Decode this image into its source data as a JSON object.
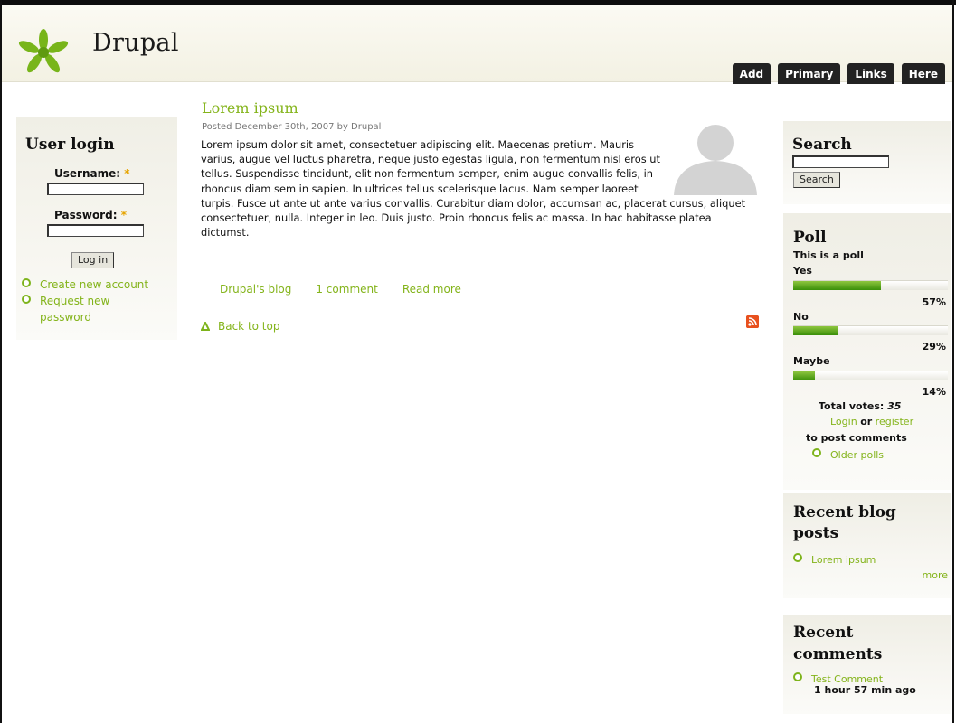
{
  "site": {
    "name": "Drupal",
    "logo_icon": "drupal-logo-icon",
    "accent_color": "#84b41b"
  },
  "nav": {
    "tabs": [
      "Add",
      "Primary",
      "Links",
      "Here"
    ]
  },
  "user_login": {
    "title": "User login",
    "username_label": "Username:",
    "password_label": "Password:",
    "required_marker": "*",
    "login_button": "Log in",
    "links": [
      "Create new account",
      "Request new password"
    ]
  },
  "post": {
    "title": "Lorem ipsum",
    "meta": "Posted December 30th, 2007 by Drupal",
    "body": "Lorem ipsum dolor sit amet, consectetuer adipiscing elit. Maecenas pretium. Mauris varius, augue vel luctus pharetra, neque justo egestas ligula, non fermentum nisl eros ut tellus. Suspendisse tincidunt, elit non fermentum semper, enim augue convallis felis, in rhoncus diam sem in sapien. In ultrices tellus scelerisque lacus. Nam semper laoreet turpis. Fusce ut ante ut ante varius convallis. Curabitur diam dolor, accumsan ac, placerat cursus, aliquet consectetuer, nulla. Integer in leo. Duis justo. Proin rhoncus felis ac massa. In hac habitasse platea dictumst.",
    "links": [
      "Drupal's blog",
      "1 comment",
      "Read more"
    ],
    "back_to_top": "Back to top"
  },
  "search": {
    "title": "Search",
    "button": "Search"
  },
  "poll": {
    "title": "Poll",
    "question": "This is a poll",
    "choices": [
      {
        "label": "Yes",
        "percent": 57,
        "pct_text": "57%"
      },
      {
        "label": "No",
        "percent": 29,
        "pct_text": "29%"
      },
      {
        "label": "Maybe",
        "percent": 14,
        "pct_text": "14%"
      }
    ],
    "total_label": "Total votes:",
    "total_votes": "35",
    "login": "Login",
    "or": "or",
    "register": "register",
    "to_post": "to post comments",
    "older_polls": "Older polls"
  },
  "recent_blog": {
    "title_line1": "Recent blog",
    "title_line2": "posts",
    "items": [
      "Lorem ipsum"
    ],
    "more": "more"
  },
  "recent_comments": {
    "title_line1": "Recent",
    "title_line2": "comments",
    "items": [
      {
        "title": "Test Comment",
        "time": "1 hour 57 min ago"
      }
    ]
  }
}
